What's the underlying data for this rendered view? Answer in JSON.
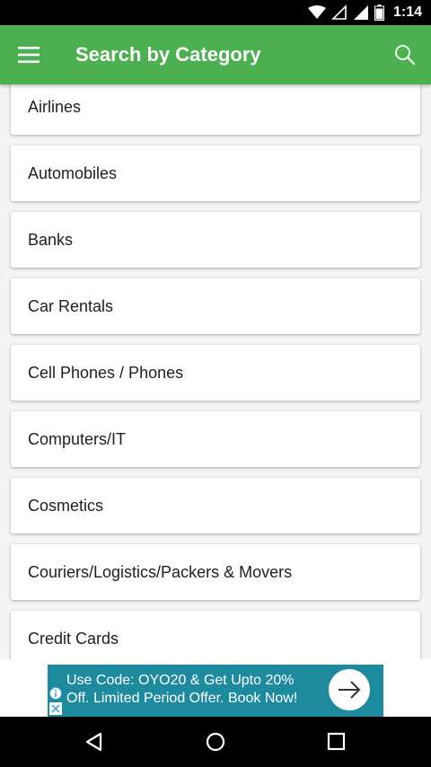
{
  "status_bar": {
    "time": "1:14",
    "icons": [
      "wifi-icon",
      "signal-empty-icon",
      "signal-full-icon",
      "battery-icon"
    ]
  },
  "app_bar": {
    "title": "Search by Category",
    "left_icon": "menu-icon",
    "right_icon": "search-icon",
    "color": "#4caf50"
  },
  "categories": [
    {
      "label": "Airlines"
    },
    {
      "label": "Automobiles"
    },
    {
      "label": "Banks"
    },
    {
      "label": "Car Rentals"
    },
    {
      "label": "Cell Phones / Phones"
    },
    {
      "label": "Computers/IT"
    },
    {
      "label": "Cosmetics"
    },
    {
      "label": "Couriers/Logistics/Packers & Movers"
    },
    {
      "label": "Credit Cards"
    }
  ],
  "ad": {
    "line1": "Use Code: OYO20 & Get Upto 20%",
    "line2": "Off. Limited Period Offer. Book Now!",
    "color": "#1e8a9e"
  },
  "nav_bar": {
    "icons": [
      "back-icon",
      "home-icon",
      "recents-icon"
    ]
  }
}
